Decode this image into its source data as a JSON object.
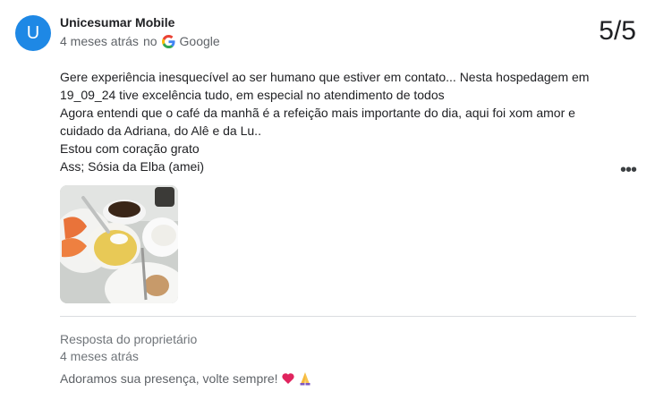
{
  "review": {
    "author_initial": "U",
    "author_name": "Unicesumar Mobile",
    "time": "4 meses atrás",
    "source_prefix": "no",
    "source": "Google",
    "rating": "5/5",
    "lines": [
      "Gere experiência inesquecível ao ser humano que estiver em contato... Nesta hospedagem em",
      "19_09_24 tive excelência tudo, em especial no atendimento de todos",
      "Agora entendi que o café da manhã é a refeição mais importante do dia, aqui foi xom amor e",
      "cuidado da Adriana, do Alê e da Lu..",
      "Estou com coração grato",
      "Ass; Sósia da Elba (amei)"
    ],
    "photo_icon": "breakfast-photo"
  },
  "owner_response": {
    "label": "Resposta do proprietário",
    "time": "4 meses atrás",
    "text": "Adoramos sua presença, volte sempre!",
    "icons": [
      "heart-icon",
      "praying-hands-icon"
    ]
  },
  "colors": {
    "avatar_bg": "#1e88e5",
    "text": "#202124",
    "secondary_text": "#5f6368",
    "divider": "#dadce0"
  }
}
